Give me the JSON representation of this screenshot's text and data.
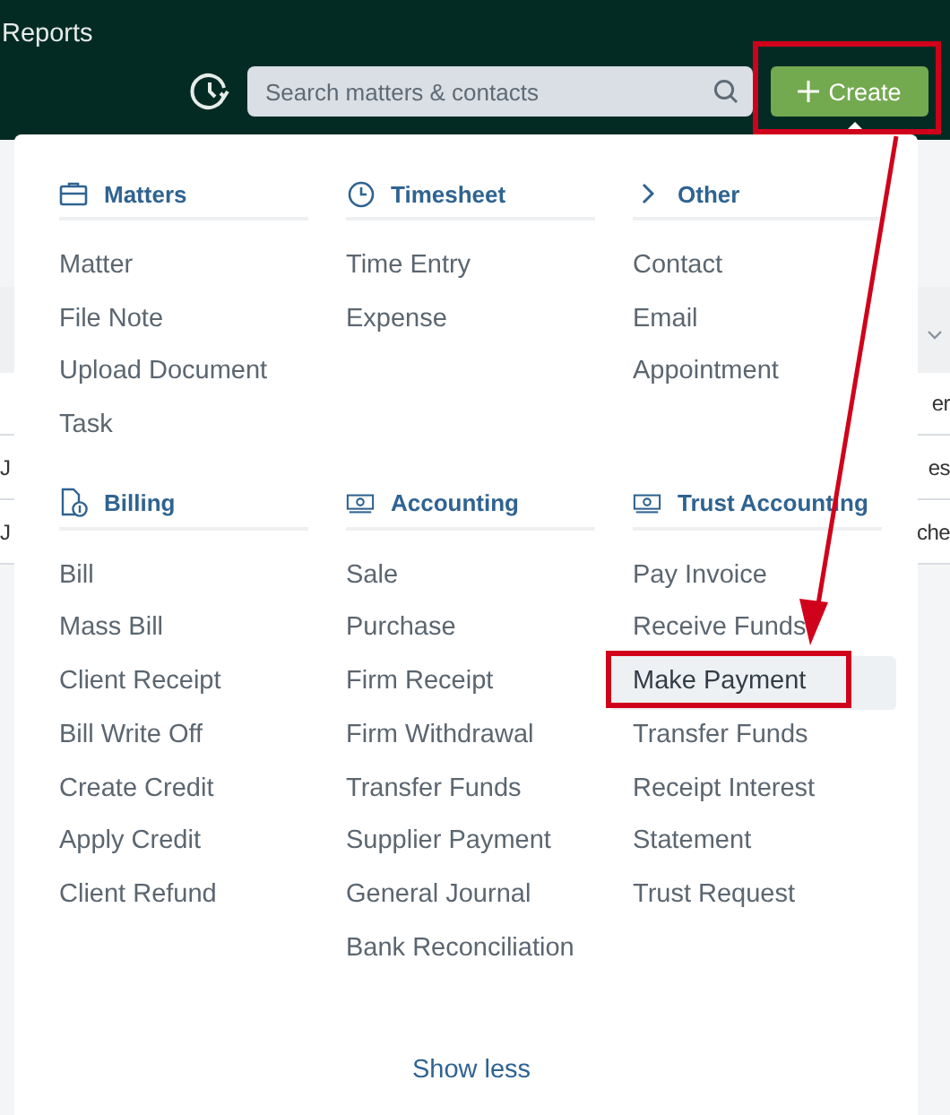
{
  "header": {
    "title": "Reports",
    "search": {
      "placeholder": "Search matters & contacts"
    },
    "create_button": "Create"
  },
  "page_rows": [
    {
      "chevron": true
    },
    {
      "right": "er"
    },
    {
      "left": "J",
      "right": "es"
    },
    {
      "left": "J",
      "right": "che"
    }
  ],
  "create_menu": {
    "sections": [
      {
        "title": "Matters",
        "items": [
          {
            "label": "Matter",
            "selected": false
          },
          {
            "label": "File Note",
            "selected": false
          },
          {
            "label": "Upload Document",
            "selected": false
          },
          {
            "label": "Task",
            "selected": false
          }
        ]
      },
      {
        "title": "Timesheet",
        "items": [
          {
            "label": "Time Entry",
            "selected": false
          },
          {
            "label": "Expense",
            "selected": false
          }
        ]
      },
      {
        "title": "Other",
        "items": [
          {
            "label": "Contact",
            "selected": false
          },
          {
            "label": "Email",
            "selected": false
          },
          {
            "label": "Appointment",
            "selected": false
          }
        ]
      },
      {
        "title": "Billing",
        "items": [
          {
            "label": "Bill",
            "selected": false
          },
          {
            "label": "Mass Bill",
            "selected": false
          },
          {
            "label": "Client Receipt",
            "selected": false
          },
          {
            "label": "Bill Write Off",
            "selected": false
          },
          {
            "label": "Create Credit",
            "selected": false
          },
          {
            "label": "Apply Credit",
            "selected": false
          },
          {
            "label": "Client Refund",
            "selected": false
          }
        ]
      },
      {
        "title": "Accounting",
        "items": [
          {
            "label": "Sale",
            "selected": false
          },
          {
            "label": "Purchase",
            "selected": false
          },
          {
            "label": "Firm Receipt",
            "selected": false
          },
          {
            "label": "Firm Withdrawal",
            "selected": false
          },
          {
            "label": "Transfer Funds",
            "selected": false
          },
          {
            "label": "Supplier Payment",
            "selected": false
          },
          {
            "label": "General Journal",
            "selected": false
          },
          {
            "label": "Bank Reconciliation",
            "selected": false
          }
        ]
      },
      {
        "title": "Trust Accounting",
        "items": [
          {
            "label": "Pay Invoice",
            "selected": false
          },
          {
            "label": "Receive Funds",
            "selected": false
          },
          {
            "label": "Make Payment",
            "selected": true
          },
          {
            "label": "Transfer Funds",
            "selected": false
          },
          {
            "label": "Receipt Interest",
            "selected": false
          },
          {
            "label": "Statement",
            "selected": false
          },
          {
            "label": "Trust Request",
            "selected": false
          }
        ]
      }
    ],
    "toggle_link": "Show less"
  }
}
